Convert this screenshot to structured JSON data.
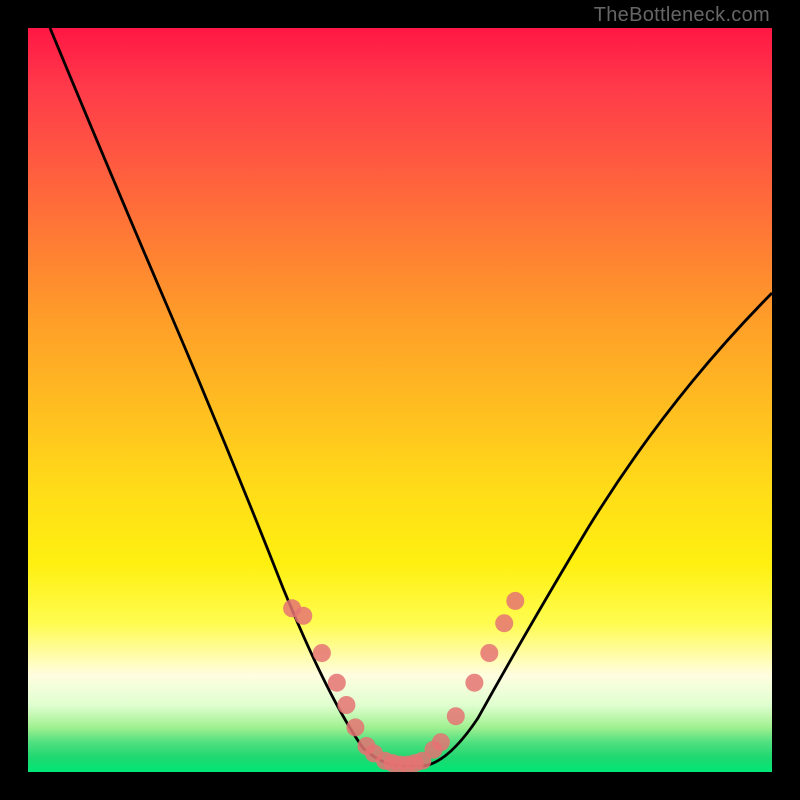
{
  "watermark": "TheBottleneck.com",
  "chart_data": {
    "type": "line",
    "title": "",
    "xlabel": "",
    "ylabel": "",
    "x_range": [
      0,
      1
    ],
    "y_range": [
      0,
      100
    ],
    "series": [
      {
        "name": "curve",
        "x": [
          0.03,
          0.1,
          0.18,
          0.26,
          0.32,
          0.36,
          0.39,
          0.42,
          0.44,
          0.46,
          0.48,
          0.5,
          0.52,
          0.54,
          0.57,
          0.6,
          0.64,
          0.69,
          0.76,
          0.84,
          0.92,
          1.0
        ],
        "y": [
          100,
          84,
          66,
          48,
          34,
          24,
          16,
          10,
          6,
          3,
          1.5,
          1,
          1,
          1.5,
          3,
          6,
          11,
          18,
          28,
          40,
          52,
          64
        ],
        "color": "#000000"
      }
    ],
    "markers": {
      "left_group": [
        {
          "x": 0.355,
          "y_pct": 78
        },
        {
          "x": 0.37,
          "y_pct": 79
        },
        {
          "x": 0.395,
          "y_pct": 84
        },
        {
          "x": 0.415,
          "y_pct": 88
        },
        {
          "x": 0.428,
          "y_pct": 91
        },
        {
          "x": 0.44,
          "y_pct": 94
        },
        {
          "x": 0.455,
          "y_pct": 96.5
        },
        {
          "x": 0.465,
          "y_pct": 97.5
        }
      ],
      "bottom_group": [
        {
          "x": 0.48,
          "y_pct": 98.5
        },
        {
          "x": 0.49,
          "y_pct": 98.8
        },
        {
          "x": 0.5,
          "y_pct": 99
        },
        {
          "x": 0.51,
          "y_pct": 99
        },
        {
          "x": 0.52,
          "y_pct": 98.8
        },
        {
          "x": 0.53,
          "y_pct": 98.5
        }
      ],
      "right_group": [
        {
          "x": 0.545,
          "y_pct": 97
        },
        {
          "x": 0.555,
          "y_pct": 96
        },
        {
          "x": 0.575,
          "y_pct": 92.5
        },
        {
          "x": 0.6,
          "y_pct": 88
        },
        {
          "x": 0.62,
          "y_pct": 84
        },
        {
          "x": 0.64,
          "y_pct": 80
        },
        {
          "x": 0.655,
          "y_pct": 77
        }
      ],
      "color": "#e57373",
      "radius": 9
    },
    "gradient_stops": [
      {
        "pct": 0,
        "color": "#ff1744"
      },
      {
        "pct": 50,
        "color": "#ffc020"
      },
      {
        "pct": 85,
        "color": "#fffde0"
      },
      {
        "pct": 100,
        "color": "#00e676"
      }
    ]
  }
}
